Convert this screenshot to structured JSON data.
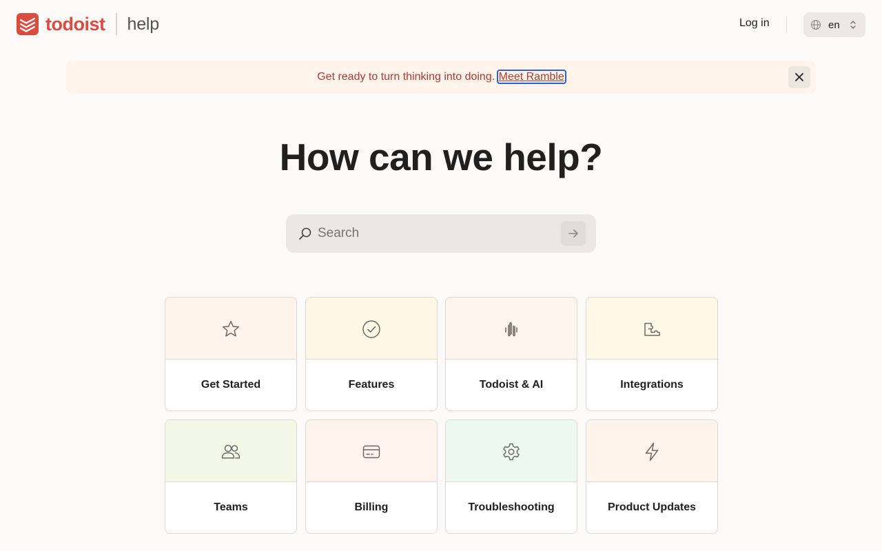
{
  "header": {
    "logo_text": "todoist",
    "help_text": "help",
    "login_label": "Log in",
    "language": "en"
  },
  "banner": {
    "text": "Get ready to turn thinking into doing.",
    "link_label": "Meet Ramble"
  },
  "hero": {
    "title": "How can we help?"
  },
  "search": {
    "placeholder": "Search"
  },
  "categories": [
    {
      "label": "Get Started",
      "icon": "star-icon",
      "bg": "#fff4ec"
    },
    {
      "label": "Features",
      "icon": "check-circle-icon",
      "bg": "#fff7e6"
    },
    {
      "label": "Todoist & AI",
      "icon": "waveform-icon",
      "bg": "#fef4ee"
    },
    {
      "label": "Integrations",
      "icon": "puzzle-icon",
      "bg": "#fff8e6"
    },
    {
      "label": "Teams",
      "icon": "users-icon",
      "bg": "#f3f8e6"
    },
    {
      "label": "Billing",
      "icon": "credit-card-icon",
      "bg": "#fef3ec"
    },
    {
      "label": "Troubleshooting",
      "icon": "gear-icon",
      "bg": "#eef8f3"
    },
    {
      "label": "Product Updates",
      "icon": "lightning-icon",
      "bg": "#fef4ec"
    }
  ],
  "colors": {
    "brand": "#dc4c3e",
    "banner_text": "#b7392c",
    "background": "#fcfaf8"
  }
}
